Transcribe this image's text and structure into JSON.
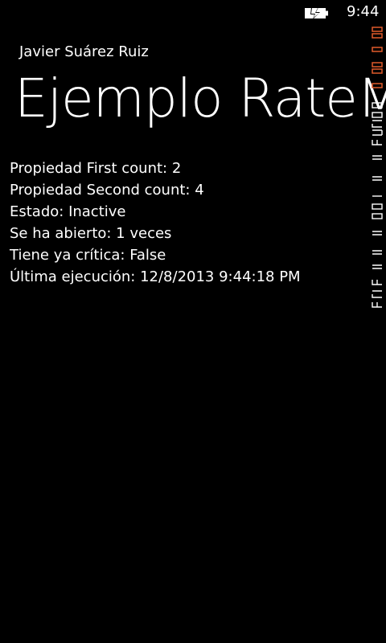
{
  "status_bar": {
    "time": "9:44",
    "battery_icon": "battery-charging-icon"
  },
  "header": {
    "app_title": "Javier Suárez Ruiz",
    "page_title": "Ejemplo RateMy"
  },
  "content": {
    "rows": [
      {
        "label": "Propiedad First count: 2"
      },
      {
        "label": "Propiedad Second count: 4"
      },
      {
        "label": "Estado: Inactive"
      },
      {
        "label": "Se ha abierto: 1 veces"
      },
      {
        "label": "Tiene ya crítica: False"
      },
      {
        "label": "Última ejecución: 12/8/2013 9:44:18 PM"
      }
    ]
  },
  "frame_counter": {
    "colors": {
      "red": "#e05a2a",
      "white": "#ffffff"
    }
  }
}
